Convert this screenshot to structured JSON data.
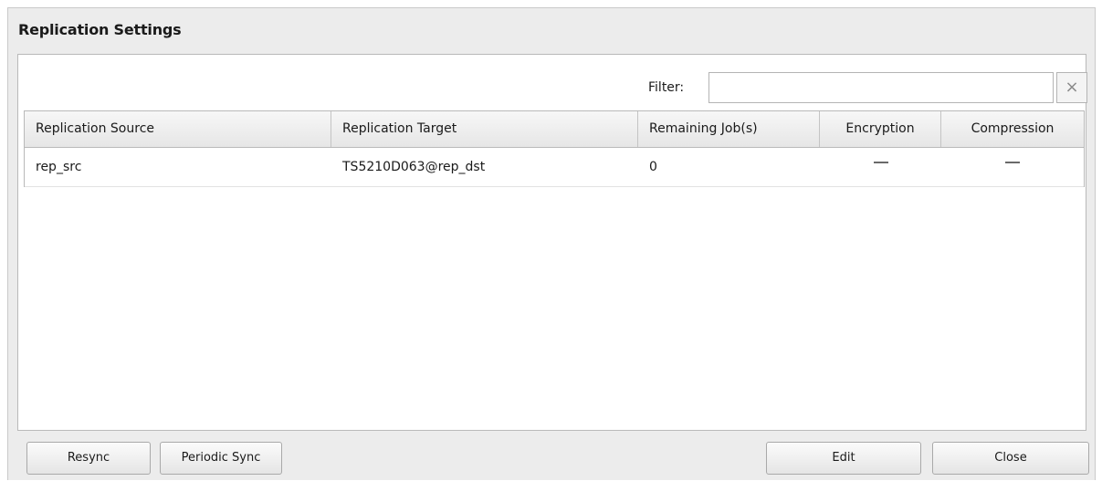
{
  "dialog": {
    "title": "Replication Settings"
  },
  "filter": {
    "label": "Filter:",
    "value": "",
    "placeholder": "",
    "clear_glyph": "×"
  },
  "table": {
    "columns": [
      "Replication Source",
      "Replication Target",
      "Remaining Job(s)",
      "Encryption",
      "Compression"
    ],
    "rows": [
      {
        "source": "rep_src",
        "target": "TS5210D063@rep_dst",
        "remaining_jobs": "0",
        "encryption": "—",
        "compression": "—"
      }
    ]
  },
  "buttons": {
    "resync": "Resync",
    "periodic_sync": "Periodic Sync",
    "edit": "Edit",
    "close": "Close"
  }
}
